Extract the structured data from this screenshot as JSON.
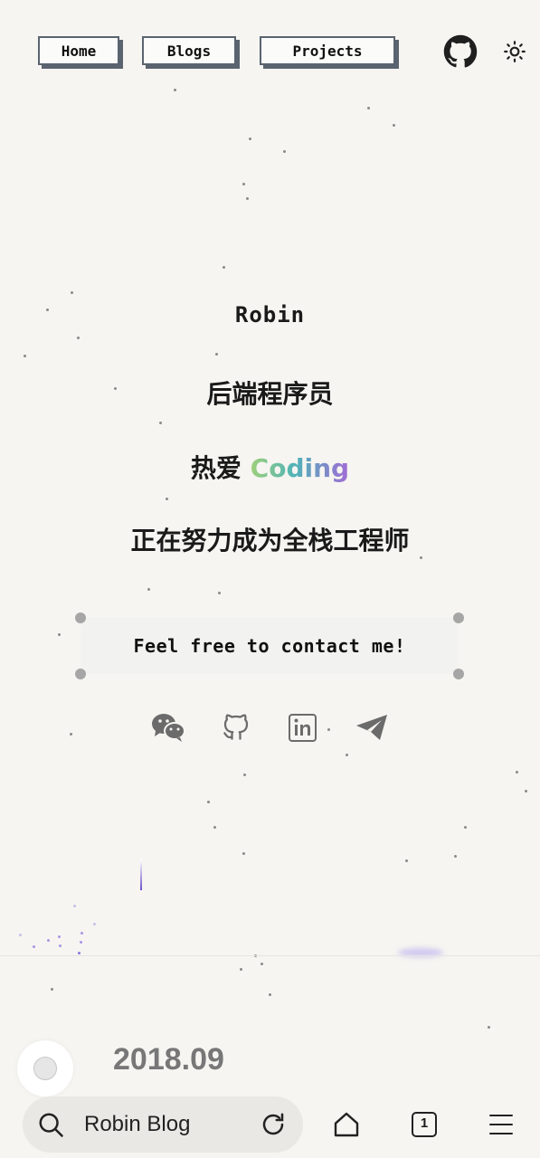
{
  "nav": {
    "home": "Home",
    "blogs": "Blogs",
    "projects": "Projects"
  },
  "hero": {
    "name": "Robin",
    "role": "后端程序员",
    "love_prefix": "热爱",
    "love_word": "Coding",
    "goal": "正在努力成为全栈工程师",
    "contact": "Feel free to contact me!"
  },
  "timeline": {
    "year": "2018.09"
  },
  "browser": {
    "address_text": "Robin Blog",
    "tab_count": "1"
  },
  "icons": {
    "github": "github-icon",
    "theme": "sun-icon",
    "wechat": "wechat-icon",
    "linkedin": "linkedin-icon",
    "telegram": "telegram-icon"
  },
  "colors": {
    "background": "#f6f5f1",
    "border": "#5a6470",
    "icon_gray": "#6b6b6b"
  }
}
